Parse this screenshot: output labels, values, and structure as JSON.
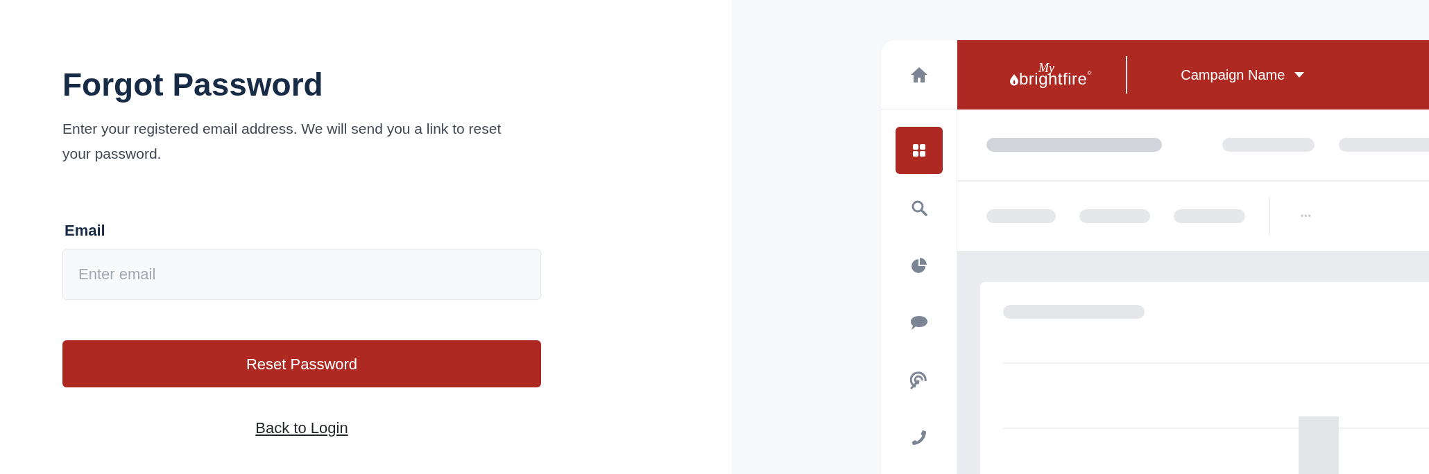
{
  "form": {
    "title": "Forgot Password",
    "description": "Enter your registered email address. We will send you a link to reset your password.",
    "email_label": "Email",
    "email_placeholder": "Enter email",
    "submit": "Reset Password",
    "back_link": "Back to Login"
  },
  "preview": {
    "logo_script": "My",
    "logo_word": "brightfire",
    "logo_mark": "®",
    "campaign": "Campaign Name",
    "sidebar": [
      {
        "kind": "home",
        "selected": false
      },
      {
        "kind": "grid",
        "selected": true
      },
      {
        "kind": "search",
        "selected": false
      },
      {
        "kind": "pie",
        "selected": false
      },
      {
        "kind": "chat",
        "selected": false
      },
      {
        "kind": "target",
        "selected": false
      },
      {
        "kind": "phone",
        "selected": false
      }
    ],
    "more": "•••"
  }
}
